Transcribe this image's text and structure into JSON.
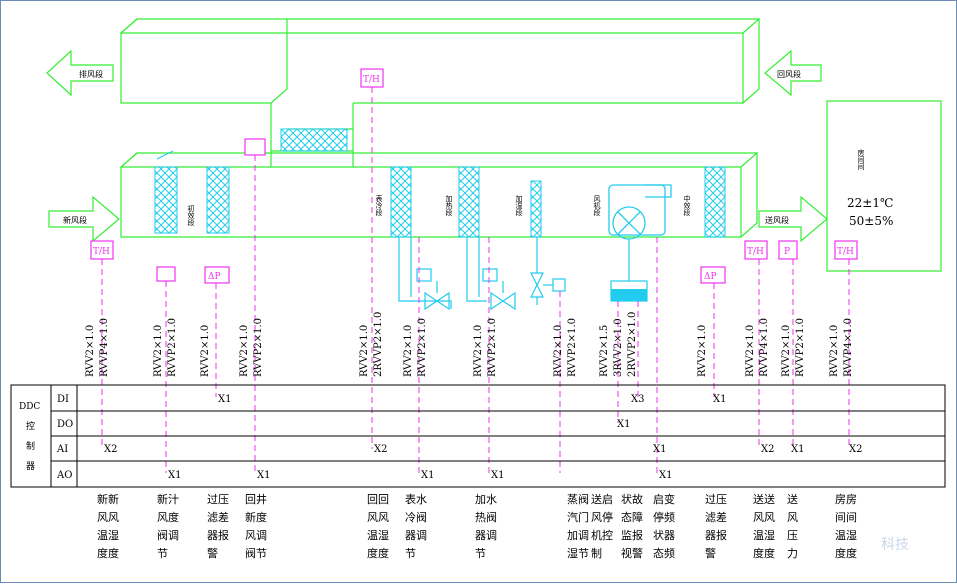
{
  "labels": {
    "exhaust_air": "排风段",
    "return_air": "回风段",
    "fresh_air": "新风段",
    "supply_air": "送风段",
    "coarse_filter": "初效段",
    "surface_cooler": "表冷段",
    "heater": "加热段",
    "humidifier": "加湿段",
    "fan": "风机段",
    "medium_filter": "中效段",
    "room_name": "房间间",
    "room_temp": "22±1℃",
    "room_humidity": "50±5%"
  },
  "sensors": {
    "th_return": "T/H",
    "th_fresh": "T/H",
    "th_supply": "T/H",
    "th_room": "T/H",
    "dp_coarse": "ΔP",
    "dp_medium": "ΔP",
    "pressure": "P"
  },
  "cables": [
    [
      "RVV2×1.0",
      "RVVP4×1.0"
    ],
    [
      "RVV2×1.0",
      "RVVP2×1.0"
    ],
    [
      "RVV2×1.0"
    ],
    [
      "RVV2×1.0",
      "RVVP2×1.0"
    ],
    [
      "RVV2×1.0",
      "2RVVP2×1.0"
    ],
    [
      "RVV2×1.0",
      "RVVP2×1.0"
    ],
    [
      "RVV2×1.0",
      "RVVP2×1.0"
    ],
    [
      "RVV2×1.0",
      "RVVP2×1.0"
    ],
    [
      "RVV2×1.5",
      "3RVV2×1.0",
      "2RVVP2×1.0"
    ],
    [
      "RVV2×1.0"
    ],
    [
      "RVV2×1.0",
      "RVVP4×1.0"
    ],
    [
      "RVV2×1.0",
      "RVVP2×1.0"
    ],
    [
      "RVV2×1.0",
      "RVVP4×1.0"
    ]
  ],
  "ddc": {
    "title": "DDC控制器",
    "rows": [
      "DI",
      "DO",
      "AI",
      "AO"
    ]
  },
  "points": [
    {
      "row": 0,
      "label": "X1"
    },
    {
      "row": 2,
      "label": "X2"
    },
    {
      "row": 3,
      "label": "X1"
    },
    {
      "row": 3,
      "label": "X1"
    },
    {
      "row": 2,
      "label": "X2"
    },
    {
      "row": 3,
      "label": "X1"
    },
    {
      "row": 3,
      "label": "X1"
    },
    {
      "row": 0,
      "label": "X3"
    },
    {
      "row": 1,
      "label": "X1"
    },
    {
      "row": 2,
      "label": "X1"
    },
    {
      "row": 3,
      "label": "X1"
    },
    {
      "row": 0,
      "label": "X1"
    },
    {
      "row": 2,
      "label": "X2"
    },
    {
      "row": 2,
      "label": "X1"
    },
    {
      "row": 2,
      "label": "X2"
    }
  ],
  "descriptions": [
    [
      "新新",
      "风风",
      "温湿",
      "度度"
    ],
    [
      "新汁",
      "风度",
      "阀调",
      "节"
    ],
    [
      "过压",
      "滤差",
      "器报",
      "警"
    ],
    [
      "回井",
      "新度",
      "风调",
      "阀节"
    ],
    [
      "回回",
      "风风",
      "温湿",
      "度度"
    ],
    [
      "表水",
      "冷阀",
      "器调",
      "节"
    ],
    [
      "加水",
      "热阀",
      "器调",
      "节"
    ],
    [
      "蒸阀",
      "汽门",
      "加调",
      "湿节"
    ],
    [
      "送启",
      "风停",
      "机控",
      "制"
    ],
    [
      "状故",
      "态障",
      "监报",
      "视警"
    ],
    [
      "启变",
      "停频",
      "状器",
      "态频"
    ],
    [
      "过压",
      "滤差",
      "器报",
      "警"
    ],
    [
      "送送",
      "风风",
      "温湿",
      "度度"
    ],
    [
      "送",
      "风",
      "压",
      "力"
    ],
    [
      "房房",
      "间间",
      "温湿",
      "度度"
    ]
  ],
  "watermark": "科技",
  "colors": {
    "duct": "#33ee33",
    "sensor": "#ee33ee",
    "coil": "#22ccee",
    "ddc_line": "#000000"
  }
}
